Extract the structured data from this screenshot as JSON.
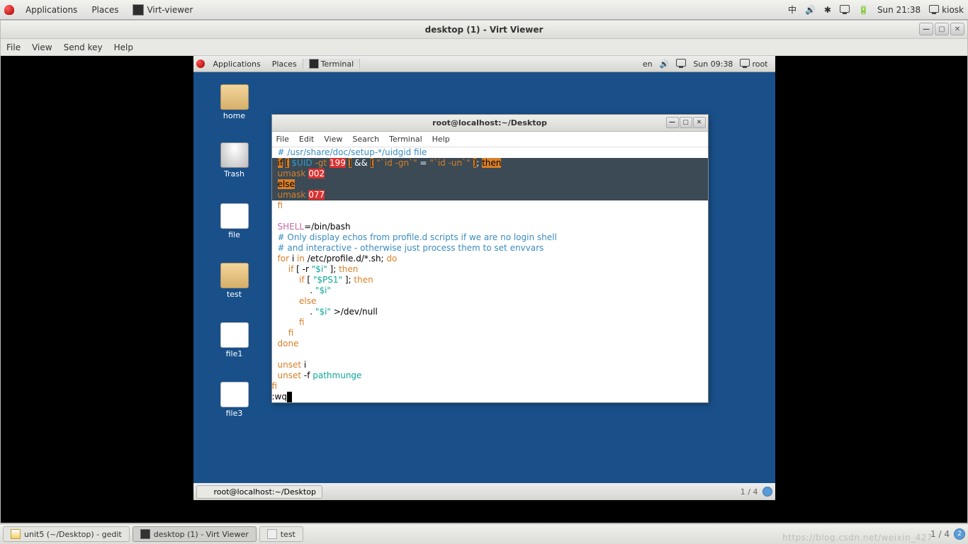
{
  "host_panel": {
    "applications": "Applications",
    "places": "Places",
    "app_name": "Virt-viewer",
    "lang_indicator": "中",
    "clock": "Sun 21:38",
    "user": "kiosk"
  },
  "vv": {
    "title": "desktop (1) - Virt Viewer",
    "menu": {
      "file": "File",
      "view": "View",
      "sendkey": "Send key",
      "help": "Help"
    }
  },
  "guest_panel": {
    "applications": "Applications",
    "places": "Places",
    "app_name": "Terminal",
    "lang": "en",
    "clock": "Sun 09:38",
    "user": "root"
  },
  "desktop_icons": {
    "home": "home",
    "trash": "Trash",
    "file": "file",
    "test": "test",
    "file1": "file1",
    "file3": "file3"
  },
  "terminal": {
    "title": "root@localhost:~/Desktop",
    "menu": {
      "file": "File",
      "edit": "Edit",
      "view": "View",
      "search": "Search",
      "terminal": "Terminal",
      "help": "Help"
    },
    "code": {
      "l1_cmt": "# /usr/share/doc/setup-*/uidgid file",
      "l2_if": "if",
      "l2_lb": "[",
      "l2_var": "$UID",
      "l2_gt": "-gt",
      "l2_num": "199",
      "l2_rb": "]",
      "l2_and": "&&",
      "l2_lb2": "[",
      "l2_q1": "\"`id -gn`\"",
      "l2_eq": "=",
      "l2_q2": "\"`id -un`\"",
      "l2_rb2": "]",
      "l2_sc": ";",
      "l2_then": "then",
      "l3_umask": "umask",
      "l3_v": "002",
      "l4_else": "else",
      "l5_umask": "umask",
      "l5_v": "077",
      "l6_fi": "fi",
      "l7_var": "SHELL",
      "l7_rest": "=/bin/bash",
      "l8": "# Only display echos from profile.d scripts if we are no login shell",
      "l9": "# and interactive - otherwise just process them to set envvars",
      "l10_for": "for",
      "l10_i": " i ",
      "l10_in": "in",
      "l10_path": " /etc/profile.d/*.sh; ",
      "l10_do": "do",
      "l11_if": "if",
      "l11_r": " [ -r ",
      "l11_i": "\"$i\"",
      "l11_r2": " ]; ",
      "l11_then": "then",
      "l12_if": "if",
      "l12_r": " [ ",
      "l12_ps": "\"$PS1\"",
      "l12_r2": " ]; ",
      "l12_then": "then",
      "l13_dot": ". ",
      "l13_i": "\"$i\"",
      "l14_else": "else",
      "l15_dot": ". ",
      "l15_i": "\"$i\"",
      "l15_dev": " >/dev/null",
      "l16_fi": "fi",
      "l17_fi": "fi",
      "l18_done": "done",
      "l20_unset": "unset",
      "l20_i": " i",
      "l21_unset": "unset",
      "l21_f": " -f ",
      "l21_pm": "pathmunge",
      "l22_fi": "fi",
      "cmd": ":wq"
    }
  },
  "guest_bottom": {
    "task": "root@localhost:~/Desktop",
    "ws": "1 / 4"
  },
  "host_taskbar": {
    "t1": "unit5 (~/Desktop) - gedit",
    "t2": "desktop (1) - Virt Viewer",
    "t3": "test",
    "ws": "1 / 4",
    "ws_num": "2"
  },
  "watermark": "https://blog.csdn.net/weixin_427"
}
